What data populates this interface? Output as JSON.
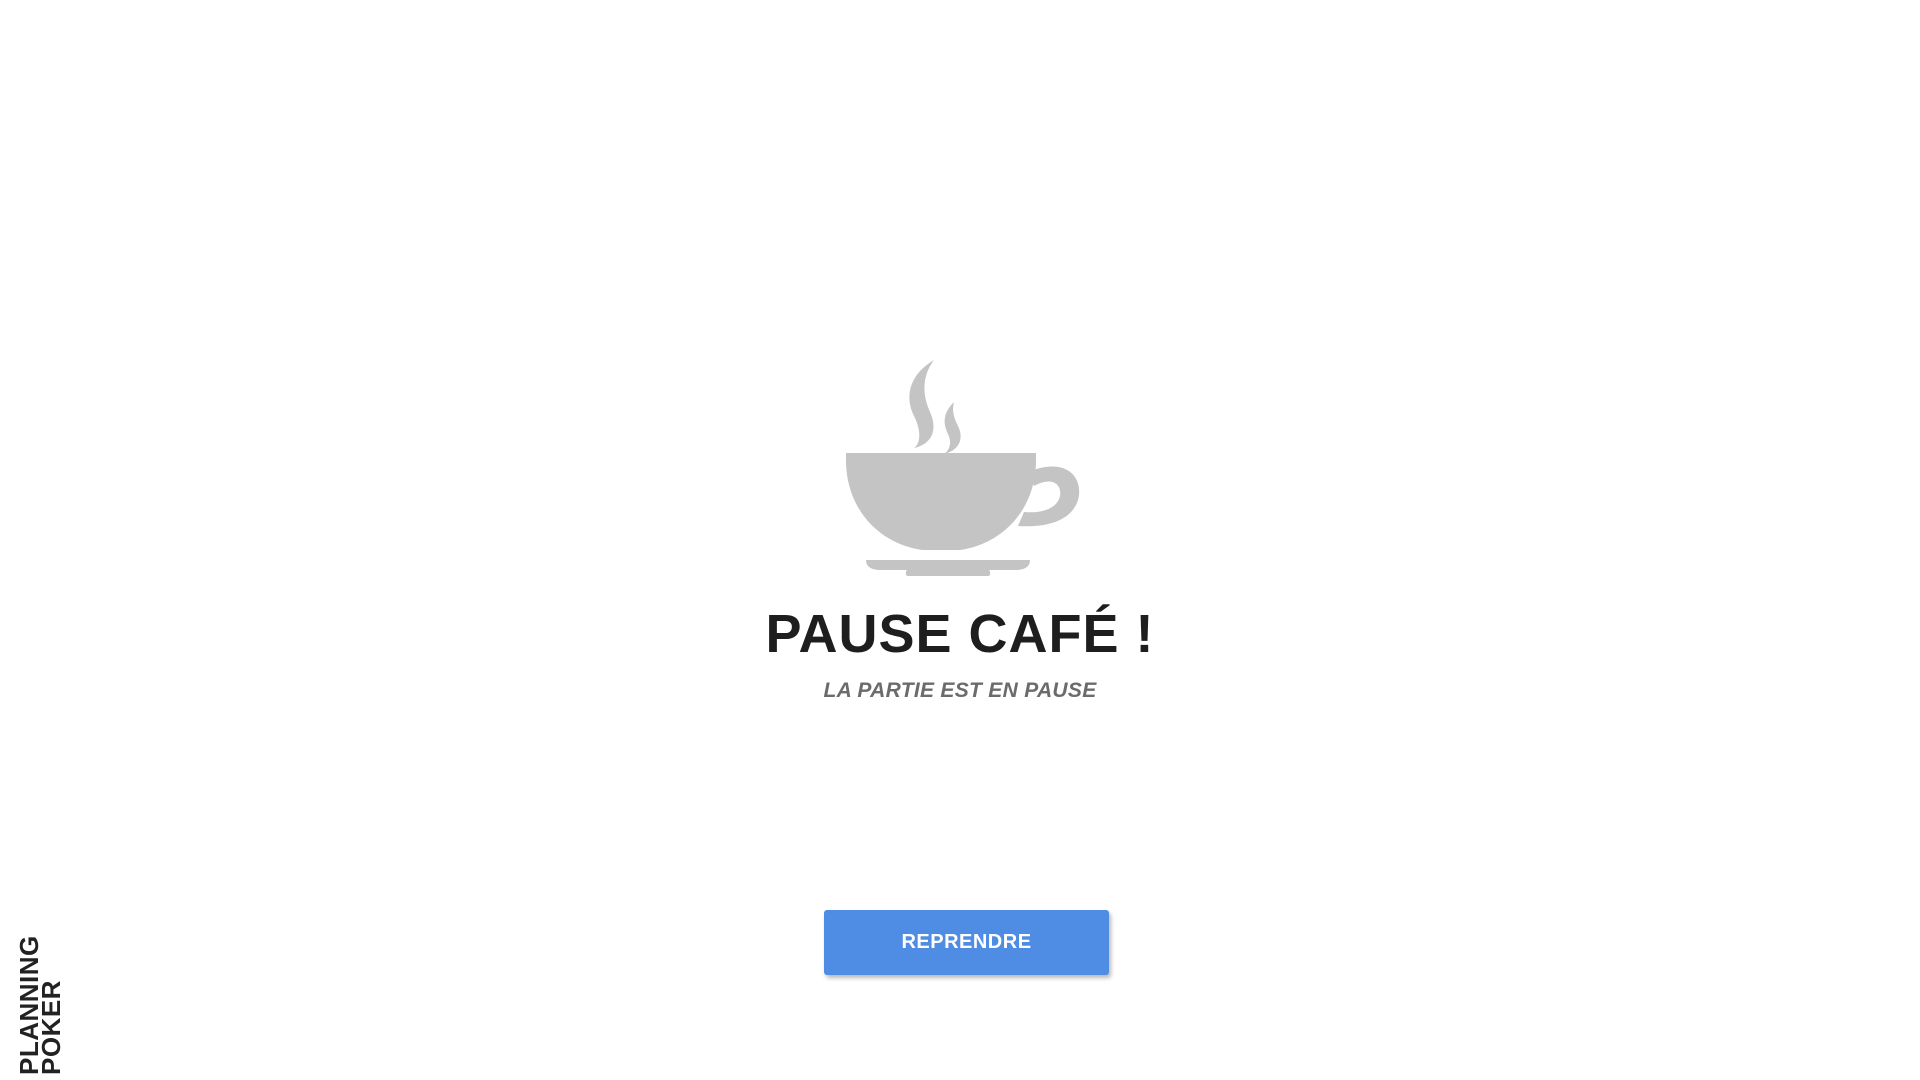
{
  "pause": {
    "icon": "coffee-cup-icon",
    "title": "PAUSE CAFÉ !",
    "subtitle": "LA PARTIE EST EN PAUSE"
  },
  "actions": {
    "resume_label": "REPRENDRE"
  },
  "logo": {
    "line1": "PLANNING",
    "line2": "POKER"
  },
  "colors": {
    "button": "#4f8ce4",
    "icon": "#c4c4c4",
    "title": "#1e1e1e",
    "subtitle": "#6b6b6b"
  }
}
